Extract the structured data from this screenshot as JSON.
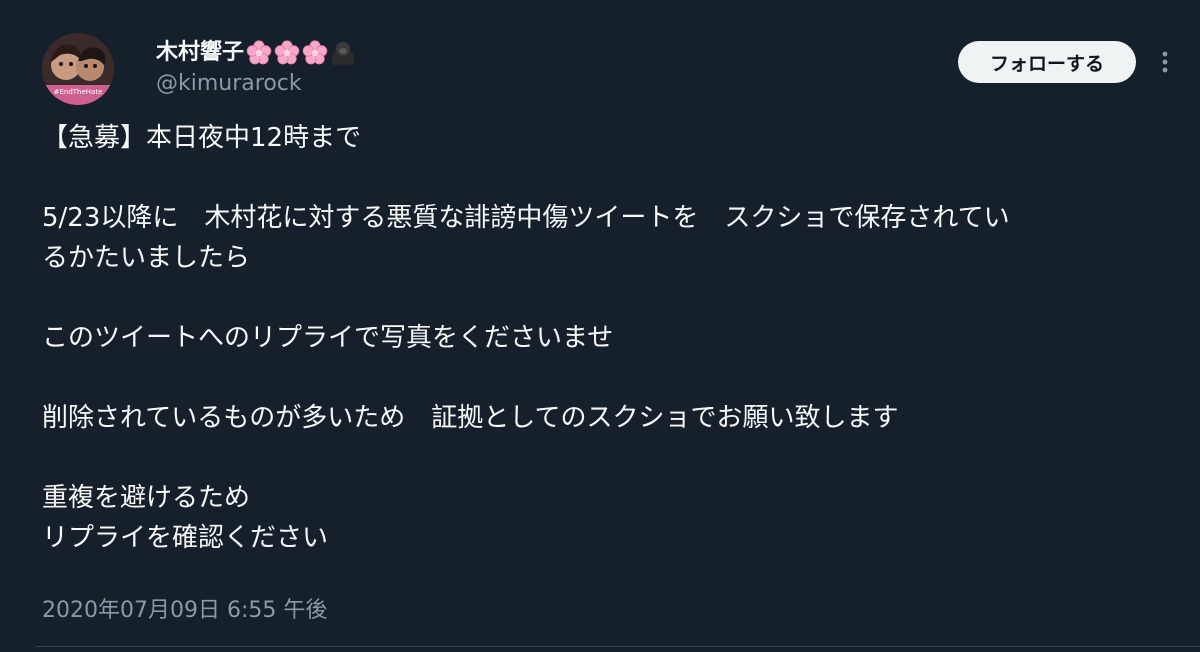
{
  "user": {
    "display_name": "木村響子",
    "handle": "@kimurarock",
    "avatar_caption": "#EndTheHate",
    "name_emojis": [
      "flower-icon",
      "flower-icon",
      "flower-icon",
      "gorilla-icon"
    ]
  },
  "actions": {
    "follow_label": "フォローする",
    "more_icon": "more-vertical-icon"
  },
  "tweet": {
    "lines": [
      "【急募】本日夜中12時まで",
      "",
      "5/23以降に　木村花に対する悪質な誹謗中傷ツイートを　スクショで保存されてい",
      "るかたいましたら",
      "",
      "このツイートへのリプライで写真をくださいませ",
      "",
      "削除されているものが多いため　証拠としてのスクショでお願い致します",
      "",
      "重複を避けるため",
      "リプライを確認ください"
    ],
    "timestamp": "2020年07月09日 6:55 午後"
  },
  "colors": {
    "background": "#15202b",
    "text": "#f7f9f9",
    "muted": "#8b98a5",
    "button_bg": "#eff3f4",
    "button_text": "#0f1419",
    "flower": "#f7a8c8"
  }
}
